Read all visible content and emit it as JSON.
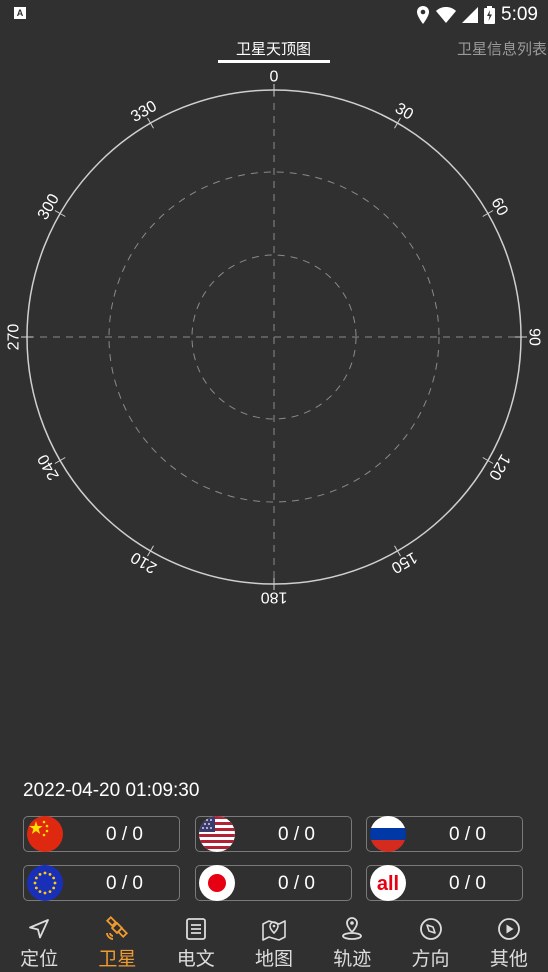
{
  "status_bar": {
    "time": "5:09",
    "app_icon_letter": "A"
  },
  "tabs": [
    {
      "label": "卫星天顶图",
      "active": true
    },
    {
      "label": "卫星信息列表",
      "active": false
    }
  ],
  "skyplot": {
    "azimuth_labels": [
      "0",
      "30",
      "60",
      "90",
      "120",
      "150",
      "180",
      "210",
      "240",
      "270",
      "300",
      "330"
    ]
  },
  "datetime": "2022-04-20  01:09:30",
  "satellite_systems": [
    {
      "system": "china-flag",
      "count": "0 / 0"
    },
    {
      "system": "usa-flag",
      "count": "0 / 0"
    },
    {
      "system": "russia-flag",
      "count": "0 / 0"
    },
    {
      "system": "eu-flag",
      "count": "0 / 0"
    },
    {
      "system": "japan-flag",
      "count": "0 / 0"
    },
    {
      "system": "all-icon",
      "count": "0 / 0",
      "icon_text": "all"
    }
  ],
  "bottom_nav": [
    {
      "label": "定位",
      "icon": "navigation-arrow-icon",
      "active": false
    },
    {
      "label": "卫星",
      "icon": "satellite-icon",
      "active": true
    },
    {
      "label": "电文",
      "icon": "document-icon",
      "active": false
    },
    {
      "label": "地图",
      "icon": "map-pin-icon",
      "active": false
    },
    {
      "label": "轨迹",
      "icon": "track-pin-icon",
      "active": false
    },
    {
      "label": "方向",
      "icon": "compass-icon",
      "active": false
    },
    {
      "label": "其他",
      "icon": "play-circle-icon",
      "active": false
    }
  ],
  "colors": {
    "background": "#303030",
    "accent": "#f09a30",
    "circle": "#cfcfcf",
    "grid": "#8a8a8a"
  }
}
